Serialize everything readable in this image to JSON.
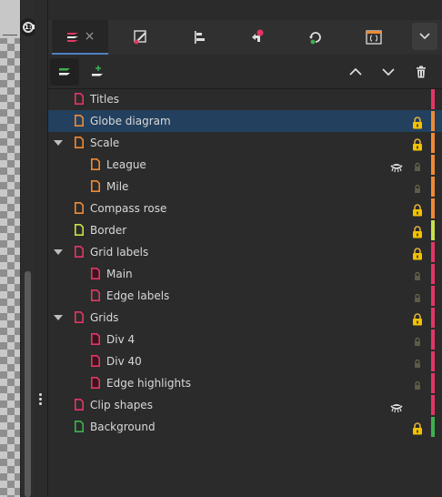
{
  "zoom_badge": "1:1",
  "tabs": [
    {
      "name": "layers",
      "close": "×"
    },
    {
      "name": "edit-path"
    },
    {
      "name": "align"
    },
    {
      "name": "undo-history"
    },
    {
      "name": "object-properties"
    },
    {
      "name": "xml-editor"
    }
  ],
  "toolbar": {
    "add_layer_title": "Add layer",
    "move_up_title": "Raise",
    "move_down_title": "Lower",
    "delete_title": "Delete"
  },
  "colors": {
    "red": "#e23664",
    "orange": "#ee8a35",
    "lime": "#c8e04a",
    "green": "#3eb04f"
  },
  "layers": [
    {
      "label": "Titles",
      "depth": 0,
      "expandable": false,
      "color": "red",
      "lock": "none",
      "hidden": false
    },
    {
      "label": "Globe diagram",
      "depth": 0,
      "expandable": false,
      "color": "orange",
      "lock": "locked",
      "hidden": false,
      "selected": true
    },
    {
      "label": "Scale",
      "depth": 0,
      "expandable": true,
      "color": "orange",
      "lock": "locked",
      "hidden": false
    },
    {
      "label": "League",
      "depth": 1,
      "expandable": false,
      "color": "orange",
      "lock": "inherited",
      "hidden": true
    },
    {
      "label": "Mile",
      "depth": 1,
      "expandable": false,
      "color": "orange",
      "lock": "inherited",
      "hidden": false
    },
    {
      "label": "Compass rose",
      "depth": 0,
      "expandable": false,
      "color": "orange",
      "lock": "locked",
      "hidden": false
    },
    {
      "label": "Border",
      "depth": 0,
      "expandable": false,
      "color": "lime",
      "lock": "locked",
      "hidden": false
    },
    {
      "label": "Grid labels",
      "depth": 0,
      "expandable": true,
      "color": "red",
      "lock": "locked",
      "hidden": false
    },
    {
      "label": "Main",
      "depth": 1,
      "expandable": false,
      "color": "red",
      "lock": "inherited",
      "hidden": false,
      "dark_icon": true
    },
    {
      "label": "Edge labels",
      "depth": 1,
      "expandable": false,
      "color": "red",
      "lock": "inherited",
      "hidden": false
    },
    {
      "label": "Grids",
      "depth": 0,
      "expandable": true,
      "color": "red",
      "lock": "locked",
      "hidden": false
    },
    {
      "label": "Div 4",
      "depth": 1,
      "expandable": false,
      "color": "red",
      "lock": "inherited",
      "hidden": false,
      "dark_icon": true
    },
    {
      "label": "Div 40",
      "depth": 1,
      "expandable": false,
      "color": "red",
      "lock": "inherited",
      "hidden": false,
      "dark_icon": true
    },
    {
      "label": "Edge highlights",
      "depth": 1,
      "expandable": false,
      "color": "red",
      "lock": "inherited",
      "hidden": false,
      "dark_icon": true
    },
    {
      "label": "Clip shapes",
      "depth": 0,
      "expandable": false,
      "color": "red",
      "lock": "none",
      "hidden": true
    },
    {
      "label": "Background",
      "depth": 0,
      "expandable": false,
      "color": "green",
      "lock": "locked",
      "hidden": false
    }
  ]
}
